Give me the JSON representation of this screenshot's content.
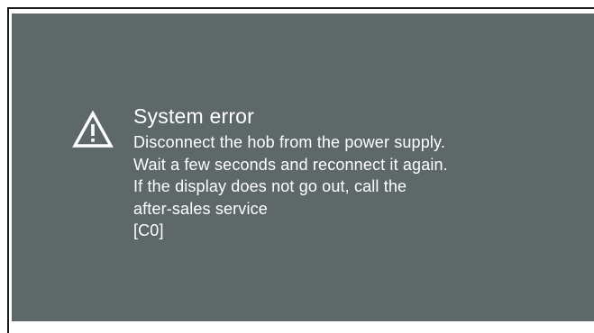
{
  "dialog": {
    "icon": "warning-icon",
    "title": "System error",
    "lines": [
      "Disconnect the hob from the power supply.",
      "Wait a few seconds and reconnect it again.",
      "If the display does not go out, call the",
      "after-sales service",
      "[C0]"
    ]
  },
  "colors": {
    "screen_background": "#5f6869",
    "text": "#ffffff",
    "frame": "#1a1a1a"
  }
}
